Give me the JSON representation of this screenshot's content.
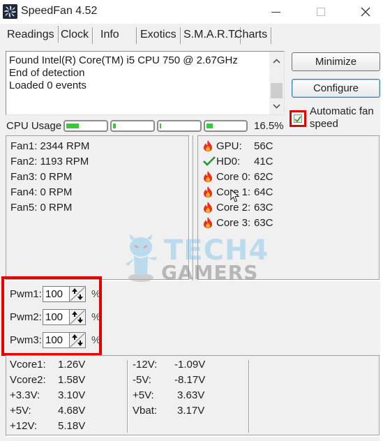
{
  "window": {
    "title": "SpeedFan 4.52",
    "icon": "speedfan-fan-icon",
    "controls": {
      "minimize": "minimize-icon",
      "maximize": "maximize-icon",
      "close": "close-icon"
    }
  },
  "tabs": [
    {
      "label": "Readings",
      "active": true
    },
    {
      "label": "Clock",
      "active": false
    },
    {
      "label": "Info",
      "active": false
    },
    {
      "label": "Exotics",
      "active": false
    },
    {
      "label": "S.M.A.R.T.",
      "active": false
    },
    {
      "label": "Charts",
      "active": false
    }
  ],
  "log": {
    "lines": [
      "Found Intel(R) Core(TM) i5 CPU 750 @ 2.67GHz",
      "End of detection",
      "Loaded 0 events"
    ]
  },
  "buttons": {
    "minimize": "Minimize",
    "configure": "Configure"
  },
  "auto_fan": {
    "label_line1": "Automatic fan",
    "label_line2": "speed",
    "checked": true,
    "highlight_color": "#e60000"
  },
  "cpu_usage": {
    "label": "CPU Usage",
    "total": "16.5%",
    "cores_fraction": [
      0.33,
      0.08,
      0.03,
      0.17
    ],
    "bar_color": "#33cc33"
  },
  "fans": [
    "Fan1: 2344 RPM",
    "Fan2: 1193 RPM",
    "Fan3: 0 RPM",
    "Fan4: 0 RPM",
    "Fan5: 0 RPM"
  ],
  "temps": [
    {
      "name": "GPU:",
      "value": "56C",
      "icon": "flame-icon"
    },
    {
      "name": "HD0:",
      "value": "41C",
      "icon": "check-icon"
    },
    {
      "name": "Core 0:",
      "value": "62C",
      "icon": "flame-icon"
    },
    {
      "name": "Core 1:",
      "value": "64C",
      "icon": "flame-icon"
    },
    {
      "name": "Core 2:",
      "value": "63C",
      "icon": "flame-icon"
    },
    {
      "name": "Core 3:",
      "value": "63C",
      "icon": "flame-icon"
    }
  ],
  "pwm": [
    {
      "label": "Pwm1:",
      "value": "100",
      "unit": "%"
    },
    {
      "label": "Pwm2:",
      "value": "100",
      "unit": "%"
    },
    {
      "label": "Pwm3:",
      "value": "100",
      "unit": "%"
    }
  ],
  "voltages": {
    "col1": [
      {
        "name": "Vcore1:",
        "value": "1.26V"
      },
      {
        "name": "Vcore2:",
        "value": "1.58V"
      },
      {
        "name": "+3.3V:",
        "value": "3.10V"
      },
      {
        "name": "+5V:",
        "value": "4.68V"
      },
      {
        "name": "+12V:",
        "value": "5.18V"
      }
    ],
    "col2": [
      {
        "name": "-12V:",
        "value": "-1.09V"
      },
      {
        "name": "-5V:",
        "value": "-8.17V"
      },
      {
        "name": "+5V:",
        "value": "3.63V"
      },
      {
        "name": "Vbat:",
        "value": "3.17V"
      }
    ]
  },
  "watermark": {
    "line1": "TECH4",
    "line2": "GAMERS"
  }
}
